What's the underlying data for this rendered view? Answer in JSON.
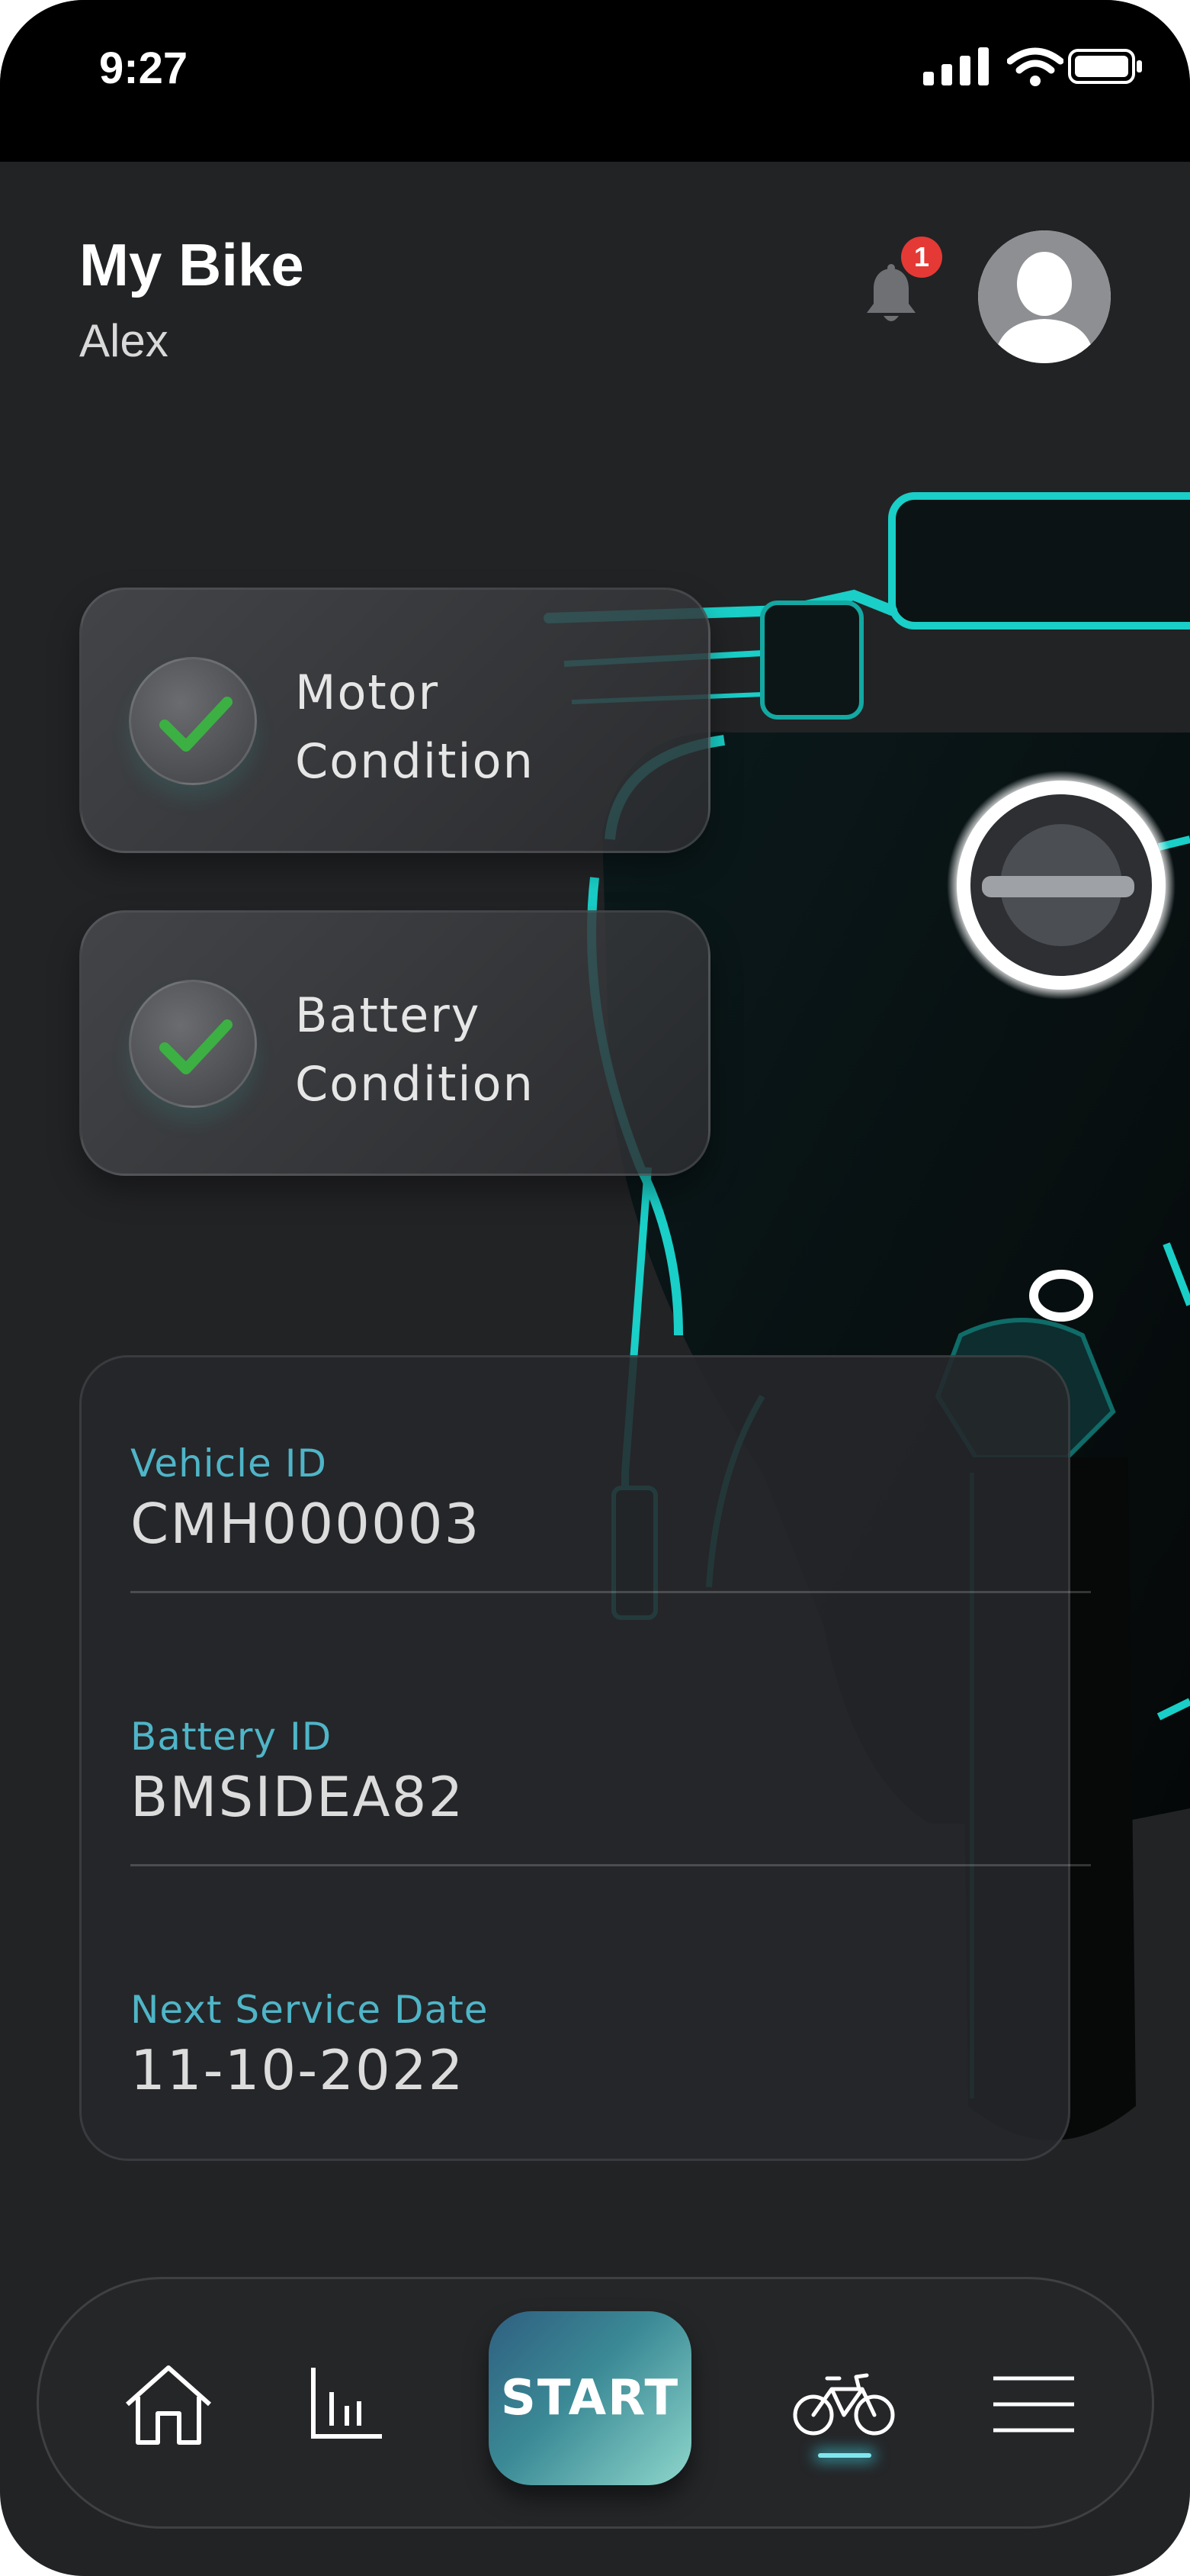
{
  "status_bar": {
    "time": "9:27",
    "icons": [
      "signal-icon",
      "wifi-icon",
      "battery-icon"
    ]
  },
  "header": {
    "title": "My Bike",
    "subtitle": "Alex",
    "notification_count": "1"
  },
  "conditions": [
    {
      "line1": "Motor",
      "line2": "Condition",
      "icon": "check-icon"
    },
    {
      "line1": "Battery",
      "line2": "Condition",
      "icon": "check-icon"
    }
  ],
  "info": {
    "vehicle_id_label": "Vehicle ID",
    "vehicle_id": "CMH000003",
    "battery_id_label": "Battery ID",
    "battery_id": "BMSIDEA82",
    "service_label": "Next Service Date",
    "service_date": "11-10-2022"
  },
  "nav": {
    "items": [
      "home-icon",
      "stats-icon",
      "bike-icon",
      "menu-icon"
    ],
    "start_label": "START",
    "active": "bike-icon"
  },
  "colors": {
    "background": "#222325",
    "accent": "#4fb5c8",
    "glow": "#18d6d0",
    "check": "#3cb043",
    "badge": "#e53935"
  }
}
